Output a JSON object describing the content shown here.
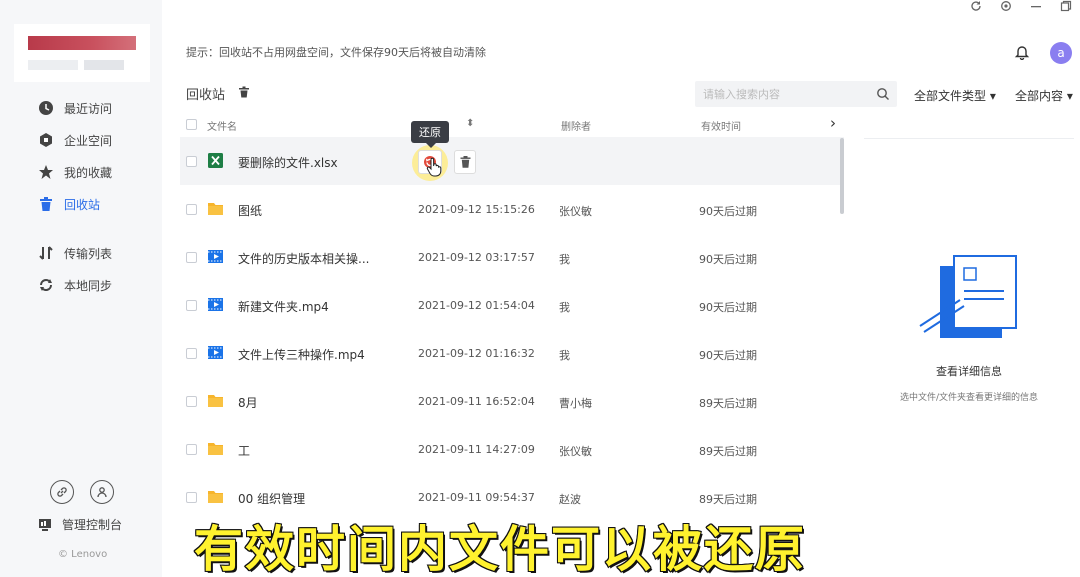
{
  "tip": "提示：回收站不占用网盘空间，文件保存90天后将被自动清除",
  "nav": [
    {
      "label": "最近访问",
      "icon": "clock-icon"
    },
    {
      "label": "企业空间",
      "icon": "enterprise-hex-icon"
    },
    {
      "label": "我的收藏",
      "icon": "star-icon"
    },
    {
      "label": "回收站",
      "icon": "trash-icon",
      "active": true
    },
    {
      "label": "传输列表",
      "icon": "transfer-icon"
    },
    {
      "label": "本地同步",
      "icon": "sync-icon"
    }
  ],
  "admin_label": "管理控制台",
  "copyright": "© Lenovo",
  "avatar_letter": "a",
  "breadcrumb": "回收站",
  "search_placeholder": "请输入搜索内容",
  "filters": {
    "type": "全部文件类型",
    "content": "全部内容"
  },
  "columns": {
    "name": "文件名",
    "deleter": "删除者",
    "expiry": "有效时间"
  },
  "tooltip": "还原",
  "rows": [
    {
      "name": "要删除的文件.xlsx",
      "type": "excel",
      "date": "",
      "deleter": "",
      "expiry": ""
    },
    {
      "name": "图纸",
      "type": "folder",
      "date": "2021-09-12 15:15:26",
      "deleter": "张仪敏",
      "expiry": "90天后过期"
    },
    {
      "name": "文件的历史版本相关操...",
      "type": "video",
      "date": "2021-09-12 03:17:57",
      "deleter": "我",
      "expiry": "90天后过期"
    },
    {
      "name": "新建文件夹.mp4",
      "type": "video",
      "date": "2021-09-12 01:54:04",
      "deleter": "我",
      "expiry": "90天后过期"
    },
    {
      "name": "文件上传三种操作.mp4",
      "type": "video",
      "date": "2021-09-12 01:16:32",
      "deleter": "我",
      "expiry": "90天后过期"
    },
    {
      "name": "8月",
      "type": "folder",
      "date": "2021-09-11 16:52:04",
      "deleter": "曹小梅",
      "expiry": "89天后过期"
    },
    {
      "name": "工",
      "type": "folder",
      "date": "2021-09-11 14:27:09",
      "deleter": "张仪敏",
      "expiry": "89天后过期"
    },
    {
      "name": "00 组织管理",
      "type": "folder",
      "date": "2021-09-11 09:54:37",
      "deleter": "赵波",
      "expiry": "89天后过期"
    }
  ],
  "detail": {
    "title": "查看详细信息",
    "subtitle": "选中文件/文件夹查看更详细的信息"
  },
  "caption": "有效时间内文件可以被还原",
  "colors": {
    "accent": "#2b6de8",
    "folder": "#f7b52c",
    "excel": "#1e7e45",
    "video": "#1a73e8",
    "caption": "#fff22e"
  }
}
